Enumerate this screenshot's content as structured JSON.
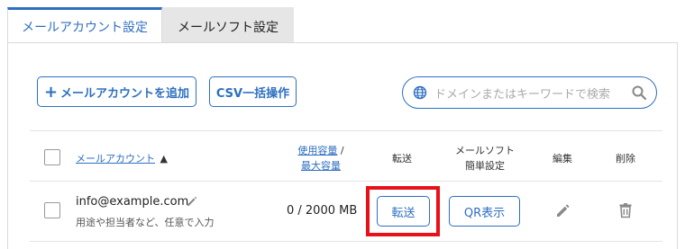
{
  "tabs": [
    {
      "label": "メールアカウント設定"
    },
    {
      "label": "メールソフト設定"
    }
  ],
  "toolbar": {
    "add_label": "メールアカウントを追加",
    "csv_label": "CSV一括操作"
  },
  "search": {
    "placeholder": "ドメインまたはキーワードで検索"
  },
  "table": {
    "headers": {
      "account": "メールアカウント",
      "sort_indicator": "▲",
      "usage_line1": "使用容量",
      "usage_sep": " /",
      "usage_line2": "最大容量",
      "forward": "転送",
      "mailsoft_line1": "メールソフト",
      "mailsoft_line2": "簡単設定",
      "edit": "編集",
      "delete": "削除"
    },
    "rows": [
      {
        "email": "info@example.com",
        "memo": "用途や担当者など、任意で入力",
        "quota": "0 / 2000 MB",
        "forward_label": "転送",
        "qr_label": "QR表示"
      }
    ]
  },
  "colors": {
    "accent": "#2e6fc1",
    "highlight": "#e8101a"
  },
  "icons": [
    "plus-icon",
    "globe-icon",
    "search-icon",
    "pencil-icon",
    "trash-icon"
  ]
}
